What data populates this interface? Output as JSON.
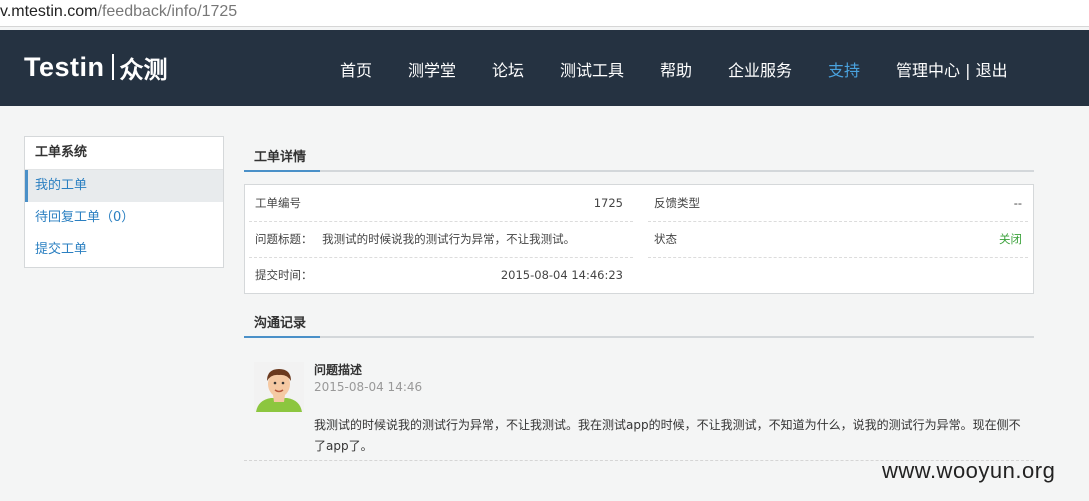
{
  "browser": {
    "url_host": "v.mtestin.com",
    "url_path": "/feedback/info/1725"
  },
  "nav": {
    "logo_text": "Testin",
    "logo_cn": "众测",
    "items": [
      "首页",
      "测学堂",
      "论坛",
      "测试工具",
      "帮助",
      "企业服务",
      "支持",
      "管理中心 | 退出"
    ],
    "active_item": "支持",
    "active_color": "#4aa3df"
  },
  "sidebar": {
    "title": "工单系统",
    "items": [
      "我的工单",
      "待回复工单（0）",
      "提交工单"
    ],
    "active_index": 0
  },
  "detail": {
    "section_title": "工单详情",
    "ticket_no_label": "工单编号",
    "ticket_no_value": "1725",
    "feedback_type_label": "反馈类型",
    "feedback_type_value": "--",
    "subject_label": "问题标题：",
    "subject_value": "我测试的时候说我的测试行为异常，不让我测试。",
    "status_label": "状态",
    "status_value": "关闭",
    "status_color": "#3aa13a",
    "submit_time_label": "提交时间：",
    "submit_time_value": "2015-08-04 14:46:23"
  },
  "communication": {
    "section_title": "沟通记录",
    "records": [
      {
        "title": "问题描述",
        "time": "2015-08-04 14:46",
        "text": "我测试的时候说我的测试行为异常，不让我测试。我在测试app的时候，不让我测试，不知道为什么，说我的测试行为异常。现在侧不了app了。"
      }
    ]
  },
  "watermark": "www.wooyun.org"
}
